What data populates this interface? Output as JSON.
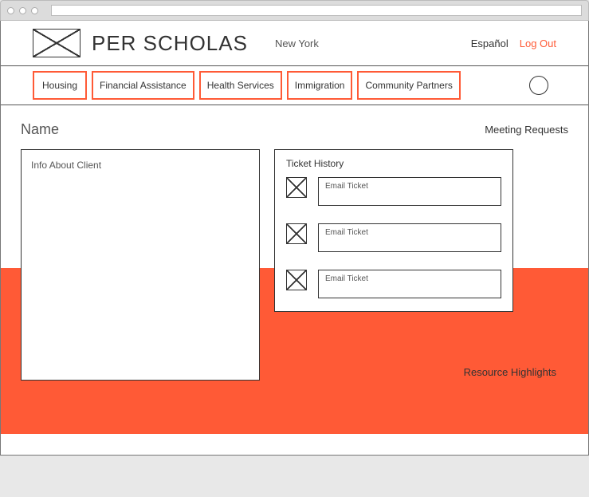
{
  "header": {
    "brand": "PER SCHOLAS",
    "location": "New York",
    "espanol": "Español",
    "logout": "Log Out"
  },
  "nav": {
    "tabs": [
      {
        "label": "Housing"
      },
      {
        "label": "Financial Assistance"
      },
      {
        "label": "Health Services"
      },
      {
        "label": "Immigration"
      },
      {
        "label": "Community Partners"
      }
    ]
  },
  "content": {
    "name_heading": "Name",
    "meeting_requests": "Meeting Requests",
    "client_info_label": "Info About Client",
    "ticket_history_title": "Ticket History",
    "tickets": [
      {
        "label": "Email Ticket"
      },
      {
        "label": "Email Ticket"
      },
      {
        "label": "Email Ticket"
      }
    ],
    "resource_highlights": "Resource Highlights"
  }
}
